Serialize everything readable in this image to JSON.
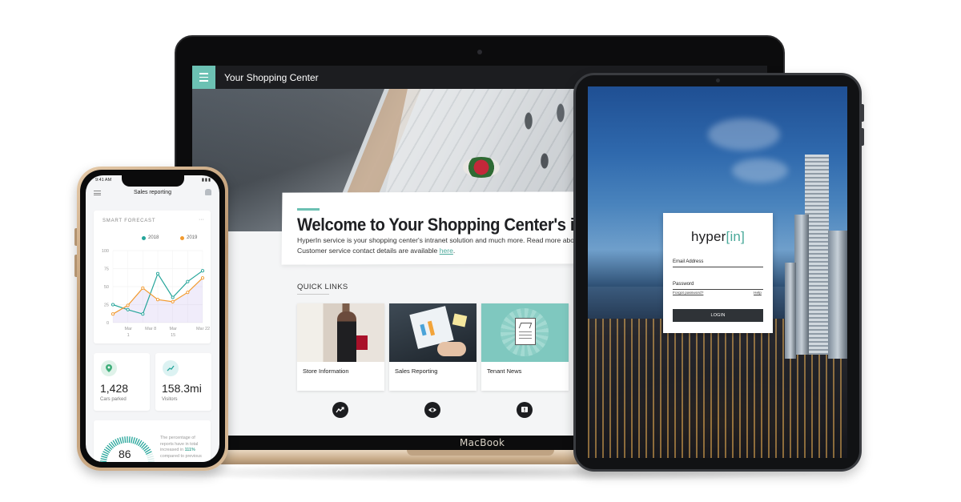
{
  "laptop": {
    "brand_label": "MacBook",
    "app_bar": {
      "title": "Your Shopping Center"
    },
    "welcome": {
      "title": "Welcome to Your Shopping Center's intranet",
      "line1": "HyperIn service is your shopping center's intranet solution and much more. Read more about the",
      "line2_prefix": "Customer service contact details are available ",
      "link": "here",
      "line2_suffix": "."
    },
    "quick_links": {
      "title": "QUICK LINKS",
      "items": [
        {
          "label": "Store Information"
        },
        {
          "label": "Sales Reporting"
        },
        {
          "label": "Tenant News"
        }
      ]
    },
    "dash_icons": [
      "trend-up-icon",
      "eye-icon",
      "alert-icon"
    ]
  },
  "tablet": {
    "logo_text": "hyper",
    "logo_bracket_open": "[",
    "logo_bracket_word": "in",
    "logo_bracket_close": "]",
    "email_label": "Email Address",
    "password_label": "Password",
    "forgot_link": "Forgot password?",
    "help_link": "Help",
    "login_button": "LOGIN"
  },
  "phone": {
    "time": "9:41 AM",
    "status": "▮▮▮",
    "title": "Sales reporting",
    "forecast": {
      "title": "SMART FORECAST",
      "menu": "···",
      "legend": [
        {
          "name": "2018",
          "color": "#25a59a"
        },
        {
          "name": "2019",
          "color": "#f29a2e"
        }
      ]
    },
    "stats": [
      {
        "value": "1,428",
        "label": "Cars parked",
        "icon": "location-pin-icon",
        "icon_bg": "#dff2e9",
        "icon_color": "#3fae7a"
      },
      {
        "value": "158.3mi",
        "label": "Visitors",
        "icon": "trend-icon",
        "icon_bg": "#dcf2f2",
        "icon_color": "#25a59a"
      }
    ],
    "gauge": {
      "value": "86",
      "text_line1": "The percentage of",
      "text_line2": "reports have in total",
      "text_line3_prefix": "increased in ",
      "text_highlight": "111%",
      "text_line4": "compared to previous"
    }
  },
  "chart_data": {
    "type": "line",
    "title": "SMART FORECAST",
    "categories": [
      "Mar 1",
      "",
      "Mar 8",
      "",
      "Mar 15",
      "",
      "Mar 22",
      ""
    ],
    "x_tick_labels": [
      "Mar 1",
      "Mar 8",
      "Mar 15",
      "Mar 22"
    ],
    "ylim": [
      0,
      100
    ],
    "y_ticks": [
      "100",
      "75",
      "50",
      "25",
      "0"
    ],
    "grid": true,
    "legend": "top-right",
    "series": [
      {
        "name": "2018",
        "color": "#25a59a",
        "values": [
          25,
          18,
          12,
          68,
          35,
          57,
          72
        ]
      },
      {
        "name": "2019",
        "color": "#f29a2e",
        "values": [
          12,
          24,
          48,
          32,
          29,
          42,
          62
        ]
      }
    ]
  }
}
